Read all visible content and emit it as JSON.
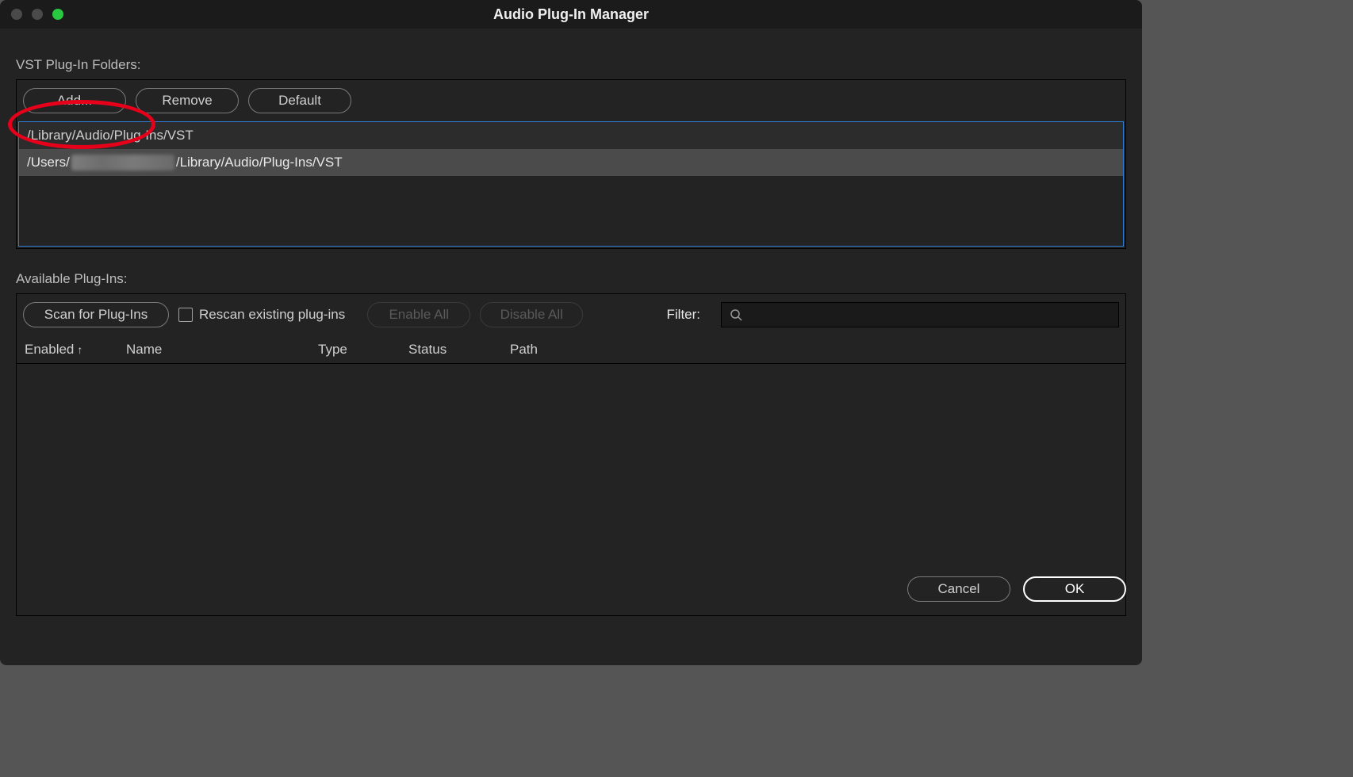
{
  "window": {
    "title": "Audio Plug-In Manager"
  },
  "folders": {
    "section_label": "VST Plug-In Folders:",
    "buttons": {
      "add": "Add...",
      "remove": "Remove",
      "default": "Default"
    },
    "rows": [
      "/Library/Audio/Plug-Ins/VST",
      {
        "prefix": "/Users/",
        "redacted": true,
        "suffix": "/Library/Audio/Plug-Ins/VST"
      }
    ]
  },
  "available": {
    "section_label": "Available Plug-Ins:",
    "buttons": {
      "scan": "Scan for Plug-Ins",
      "rescan_label": "Rescan existing plug-ins",
      "enable_all": "Enable All",
      "disable_all": "Disable All"
    },
    "filter_label": "Filter:",
    "filter_value": "",
    "columns": {
      "enabled": "Enabled",
      "name": "Name",
      "type": "Type",
      "status": "Status",
      "path": "Path"
    }
  },
  "footer": {
    "cancel": "Cancel",
    "ok": "OK"
  }
}
